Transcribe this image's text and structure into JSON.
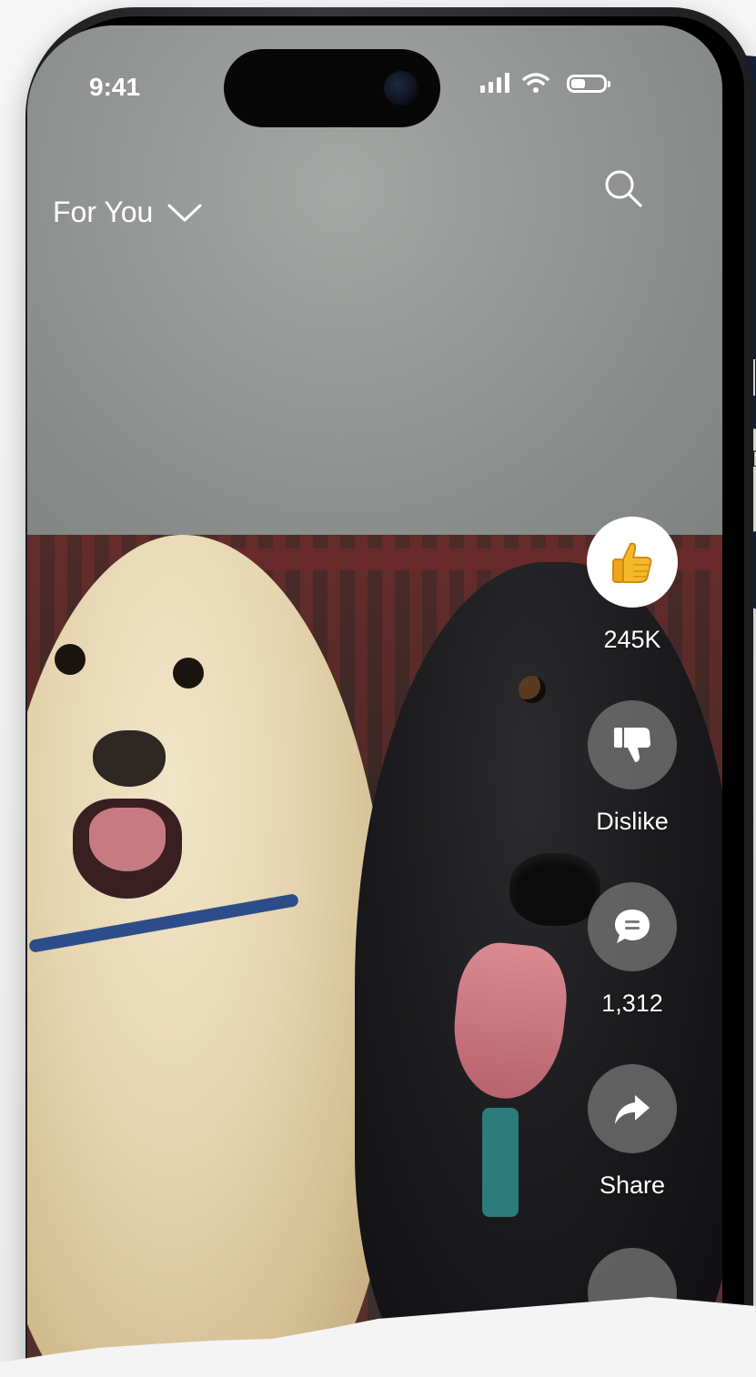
{
  "status_bar": {
    "time": "9:41",
    "battery_level": 0.45
  },
  "header": {
    "feed_label": "For You"
  },
  "actions": {
    "like_count": "245K",
    "dislike_label": "Dislike",
    "comment_count": "1,312",
    "share_label": "Share"
  },
  "icons": {
    "like": "thumbs-up-emoji",
    "dislike": "thumbs-down-icon",
    "comment": "chat-bubble-icon",
    "share": "share-arrow-icon",
    "search": "search-icon",
    "dropdown": "chevron-down-icon"
  },
  "background_text": {
    "line1": "T",
    "line2": "a"
  },
  "colors": {
    "navy_card": "#15213b",
    "like_active": "#ffffff",
    "action_bg": "#787878"
  }
}
